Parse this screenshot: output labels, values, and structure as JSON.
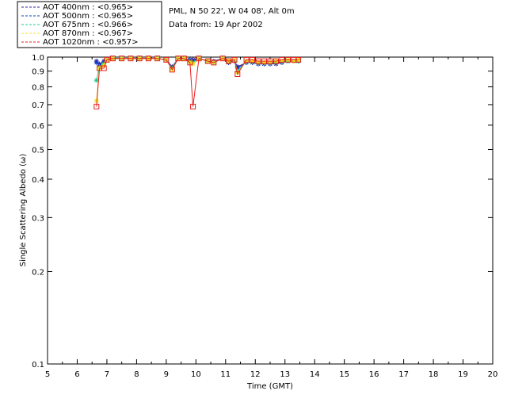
{
  "header": {
    "line1": "PML, N 50 22', W 04 08', Alt 0m",
    "line2": "Data from: 19 Apr 2002"
  },
  "chart_data": {
    "type": "line",
    "title": "",
    "xlabel": "Time (GMT)",
    "ylabel": "Single Scattering Albedo (ω)",
    "xlim": [
      5,
      20
    ],
    "ylim": [
      0.1,
      1.0
    ],
    "yscale": "log",
    "grid": false,
    "legend_position": "top-left",
    "x_ticks": [
      "5",
      "6",
      "7",
      "8",
      "9",
      "10",
      "11",
      "12",
      "13",
      "14",
      "15",
      "16",
      "17",
      "18",
      "19",
      "20"
    ],
    "y_ticks": [
      {
        "v": 1.0,
        "label": "1.0"
      },
      {
        "v": 0.9,
        "label": "0.9"
      },
      {
        "v": 0.8,
        "label": "0.8"
      },
      {
        "v": 0.7,
        "label": "0.7"
      },
      {
        "v": 0.6,
        "label": "0.6"
      },
      {
        "v": 0.5,
        "label": "0.5"
      },
      {
        "v": 0.4,
        "label": "0.4"
      },
      {
        "v": 0.3,
        "label": "0.3"
      },
      {
        "v": 0.2,
        "label": "0.2"
      },
      {
        "v": 0.1,
        "label": "0.1"
      }
    ],
    "series": [
      {
        "name": "AOT  400nm : <0.965>",
        "color": "#3c1e9c",
        "marker": "asterisk",
        "x": [
          6.65,
          6.75,
          6.9,
          7.0,
          7.2,
          7.5,
          7.8,
          8.1,
          8.4,
          8.7,
          9.0,
          9.2,
          9.4,
          9.6,
          9.8,
          9.9,
          10.1,
          10.4,
          10.6,
          10.9,
          11.1,
          11.3,
          11.4,
          11.7,
          11.9,
          12.1,
          12.3,
          12.5,
          12.7,
          12.9,
          13.1,
          13.3,
          13.45
        ],
        "values": [
          0.97,
          0.95,
          0.97,
          0.98,
          0.99,
          0.99,
          0.99,
          0.99,
          0.99,
          0.99,
          0.98,
          0.93,
          0.99,
          0.99,
          0.98,
          0.98,
          0.99,
          0.97,
          0.97,
          0.99,
          0.96,
          0.97,
          0.93,
          0.96,
          0.96,
          0.95,
          0.95,
          0.95,
          0.95,
          0.96,
          0.97,
          0.97,
          0.97
        ]
      },
      {
        "name": "AOT  500nm : <0.965>",
        "color": "#0a3cc8",
        "marker": "asterisk",
        "x": [
          6.65,
          6.75,
          6.9,
          7.0,
          7.2,
          7.5,
          7.8,
          8.1,
          8.4,
          8.7,
          9.0,
          9.2,
          9.4,
          9.6,
          9.8,
          9.9,
          10.1,
          10.4,
          10.6,
          10.9,
          11.1,
          11.3,
          11.4,
          11.7,
          11.9,
          12.1,
          12.3,
          12.5,
          12.7,
          12.9,
          13.1,
          13.3,
          13.45
        ],
        "values": [
          0.96,
          0.94,
          0.96,
          0.98,
          0.99,
          0.99,
          0.99,
          0.99,
          0.99,
          0.99,
          0.98,
          0.92,
          0.99,
          0.99,
          0.98,
          0.97,
          0.99,
          0.97,
          0.96,
          0.99,
          0.96,
          0.97,
          0.92,
          0.96,
          0.96,
          0.95,
          0.95,
          0.95,
          0.96,
          0.96,
          0.97,
          0.97,
          0.97
        ]
      },
      {
        "name": "AOT  675nm : <0.966>",
        "color": "#14d28c",
        "marker": "asterisk",
        "x": [
          6.65,
          6.75,
          6.9,
          7.0,
          7.2,
          7.5,
          7.8,
          8.1,
          8.4,
          8.7,
          9.0,
          9.2,
          9.4,
          9.6,
          9.8,
          9.9,
          10.1,
          10.4,
          10.6,
          10.9,
          11.1,
          11.3,
          11.4,
          11.7,
          11.9,
          12.1,
          12.3,
          12.5,
          12.7,
          12.9,
          13.1,
          13.3,
          13.45
        ],
        "values": [
          0.84,
          0.93,
          0.95,
          0.98,
          0.99,
          0.99,
          0.99,
          0.99,
          0.99,
          0.99,
          0.98,
          0.92,
          0.99,
          0.99,
          0.97,
          0.96,
          0.99,
          0.97,
          0.96,
          0.99,
          0.97,
          0.97,
          0.9,
          0.97,
          0.97,
          0.96,
          0.96,
          0.96,
          0.96,
          0.97,
          0.97,
          0.97,
          0.97
        ]
      },
      {
        "name": "AOT  870nm : <0.967>",
        "color": "#f0e614",
        "marker": "asterisk",
        "x": [
          6.65,
          6.75,
          6.9,
          7.0,
          7.2,
          7.5,
          7.8,
          8.1,
          8.4,
          8.7,
          9.0,
          9.2,
          9.4,
          9.6,
          9.8,
          9.9,
          10.1,
          10.4,
          10.6,
          10.9,
          11.1,
          11.3,
          11.4,
          11.7,
          11.9,
          12.1,
          12.3,
          12.5,
          12.7,
          12.9,
          13.1,
          13.3,
          13.45
        ],
        "values": [
          0.72,
          0.92,
          0.94,
          0.98,
          0.99,
          0.99,
          0.99,
          0.99,
          0.99,
          0.99,
          0.98,
          0.91,
          0.99,
          0.99,
          0.96,
          0.95,
          0.99,
          0.97,
          0.96,
          0.99,
          0.97,
          0.98,
          0.89,
          0.97,
          0.97,
          0.96,
          0.96,
          0.96,
          0.97,
          0.97,
          0.98,
          0.97,
          0.98
        ]
      },
      {
        "name": "AOT 1020nm : <0.957>",
        "color": "#e61e1e",
        "marker": "square",
        "x": [
          6.65,
          6.75,
          6.9,
          7.0,
          7.2,
          7.5,
          7.8,
          8.1,
          8.4,
          8.7,
          9.0,
          9.2,
          9.4,
          9.6,
          9.8,
          9.9,
          10.1,
          10.4,
          10.6,
          10.9,
          11.1,
          11.3,
          11.4,
          11.7,
          11.9,
          12.1,
          12.3,
          12.5,
          12.7,
          12.9,
          13.1,
          13.3,
          13.45
        ],
        "values": [
          0.69,
          0.92,
          0.92,
          0.98,
          0.99,
          0.99,
          0.99,
          0.99,
          0.99,
          0.99,
          0.98,
          0.91,
          0.99,
          0.99,
          0.96,
          0.69,
          0.99,
          0.97,
          0.96,
          0.99,
          0.97,
          0.98,
          0.88,
          0.98,
          0.98,
          0.97,
          0.97,
          0.97,
          0.97,
          0.98,
          0.98,
          0.98,
          0.98
        ]
      }
    ]
  }
}
